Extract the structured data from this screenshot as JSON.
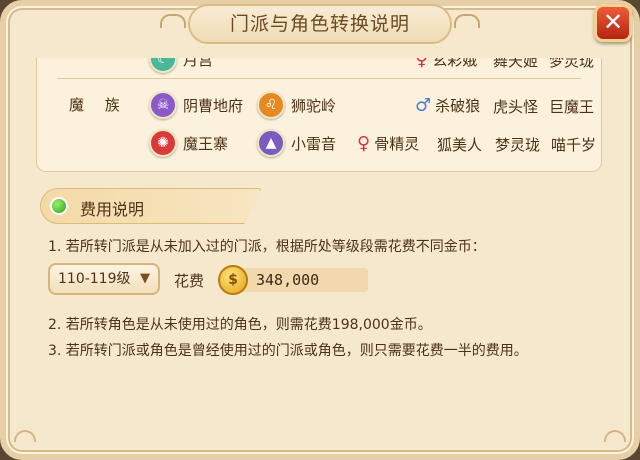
{
  "window": {
    "title": "门派与角色转换说明",
    "close_label": "✕"
  },
  "top_row_partial": {
    "sect": "月宫",
    "roles": [
      "玄彩娥",
      "舞天姬",
      "梦灵珑"
    ]
  },
  "demon_race": {
    "race_label": "魔 族",
    "sects": [
      "阴曹地府",
      "狮驼岭",
      "魔王寨",
      "小雷音"
    ],
    "male_roles": [
      "杀破狼",
      "虎头怪",
      "巨魔王"
    ],
    "female_roles": [
      "骨精灵",
      "狐美人",
      "梦灵珑",
      "喵千岁"
    ]
  },
  "fee_section": {
    "title": "费用说明",
    "note1": "1. 若所转门派是从未加入过的门派，根据所处等级段需花费不同金币：",
    "level_select_value": "110-119级",
    "cost_label": "花费",
    "cost_value": "348,000",
    "coin_glyph": "$",
    "note2": "2. 若所转角色是从未使用过的角色，则需花费198,000金币。",
    "note3": "3. 若所转门派或角色是曾经使用过的门派或角色，则只需要花费一半的费用。"
  },
  "colors": {
    "panel_bg": "#f6e8cd",
    "close_red": "#c9341c",
    "text": "#4d3218",
    "fee_dot_green": "#26a317"
  }
}
